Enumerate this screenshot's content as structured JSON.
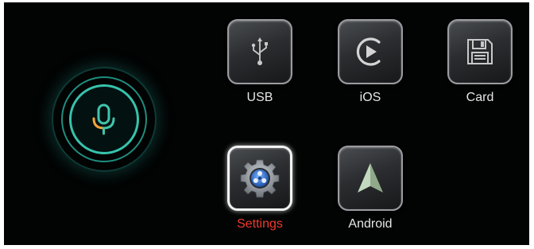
{
  "apps": {
    "usb": {
      "label": "USB",
      "icon": "usb-icon"
    },
    "ios": {
      "label": "iOS",
      "icon": "carplay-play-icon"
    },
    "card": {
      "label": "Card",
      "icon": "floppy-disk-icon"
    },
    "settings": {
      "label": "Settings",
      "icon": "gear-icon",
      "selected": true
    },
    "android": {
      "label": "Android",
      "icon": "android-auto-icon"
    }
  },
  "voice": {
    "icon": "microphone-icon"
  },
  "colors": {
    "background": "#020303",
    "accent_ring": "#37c2ac",
    "selected_label": "#f03a2c",
    "label": "#e6e6e6"
  }
}
